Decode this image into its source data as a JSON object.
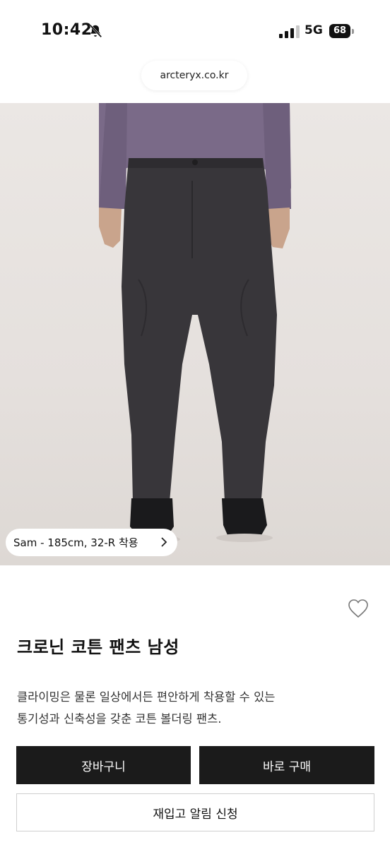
{
  "status_bar": {
    "time": "10:42",
    "network": "5G",
    "battery": "68"
  },
  "browser": {
    "url": "arcteryx.co.kr"
  },
  "product": {
    "model_info": "Sam - 185cm, 32-R 착용",
    "title": "크로닌 코튼 팬츠 남성",
    "description_line1": "클라이밍은 물론 일상에서든 편안하게 착용할 수 있는",
    "description_line2": "통기성과 신축성을 갖춘 코튼 볼더링 팬츠."
  },
  "actions": {
    "cart_label": "장바구니",
    "buy_label": "바로 구매",
    "notify_label": "재입고 알림 신청"
  },
  "icons": {
    "bell": "bell-slash-icon",
    "signal": "signal-bars-icon",
    "battery": "battery-icon",
    "chevron": "chevron-right-icon",
    "heart": "heart-outline-icon"
  },
  "colors": {
    "button_dark": "#1b1b1b",
    "shirt": "#7a6a88",
    "pants": "#38363a"
  }
}
